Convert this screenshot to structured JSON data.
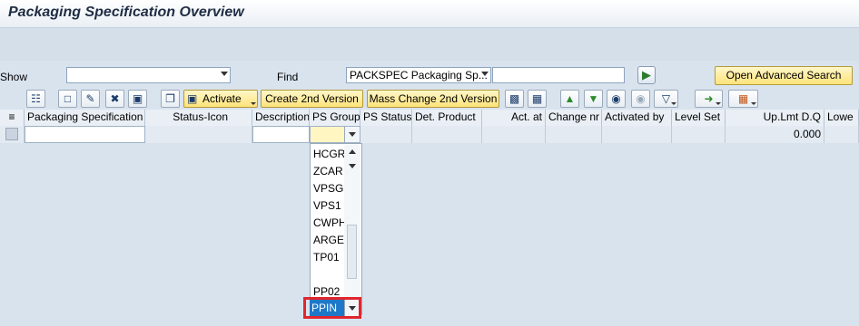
{
  "window": {
    "title": "Packaging Specification Overview"
  },
  "filter": {
    "show_label": "Show",
    "show_value": "",
    "find_label": "Find",
    "find_value": "PACKSPEC Packaging Sp...",
    "find_text": "",
    "advanced_search": "Open Advanced Search"
  },
  "toolbar": {
    "activate": "Activate",
    "create_2nd_version": "Create 2nd Version",
    "mass_change_2nd_version": "Mass Change 2nd Version"
  },
  "table": {
    "columns": [
      "Packaging Specification",
      "Status-Icon",
      "Description",
      "PS Group",
      "PS Status",
      "Det. Product",
      "Act. at",
      "Change nr",
      "Activated by",
      "Level Set",
      "Up.Lmt D.Q",
      "Lowe"
    ],
    "row": {
      "up_lmt_dq": "0.000"
    }
  },
  "ps_group_dropdown": {
    "options": [
      "HCGR",
      "ZCAR",
      "VPSG",
      "VPS1",
      "CWPH",
      "ARGE",
      "TP01",
      "",
      "PP02"
    ],
    "selected": "PPIN"
  },
  "colors": {
    "highlight_border": "#e0262e",
    "selected_bg": "#1e78c8",
    "button_yellow": "#ffe37a"
  }
}
